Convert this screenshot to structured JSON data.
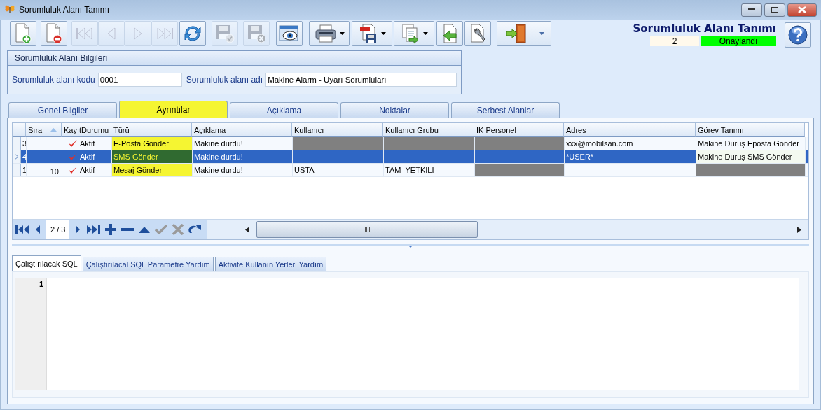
{
  "window": {
    "title": "Sorumluluk Alanı Tanımı"
  },
  "toolbar": [
    {
      "kind": "new",
      "disabled": false,
      "dropdown": false
    },
    {
      "kind": "delete",
      "disabled": false,
      "dropdown": false
    },
    {
      "kind": "first",
      "disabled": true,
      "dropdown": false
    },
    {
      "kind": "prev",
      "disabled": true,
      "dropdown": false
    },
    {
      "kind": "next",
      "disabled": true,
      "dropdown": false
    },
    {
      "kind": "last",
      "disabled": true,
      "dropdown": false
    },
    {
      "kind": "refresh",
      "disabled": false,
      "dropdown": false
    },
    {
      "kind": "save",
      "disabled": true,
      "dropdown": false
    },
    {
      "kind": "cancel",
      "disabled": true,
      "dropdown": false
    },
    {
      "kind": "preview",
      "disabled": false,
      "dropdown": false
    },
    {
      "kind": "print",
      "disabled": false,
      "dropdown": true
    },
    {
      "kind": "pdf",
      "disabled": false,
      "dropdown": true
    },
    {
      "kind": "export",
      "disabled": false,
      "dropdown": true
    },
    {
      "kind": "import",
      "disabled": false,
      "dropdown": false
    },
    {
      "kind": "tools",
      "disabled": false,
      "dropdown": false
    },
    {
      "kind": "exit",
      "disabled": false,
      "dropdown": true
    }
  ],
  "header": {
    "title": "Sorumluluk Alanı Tanımı",
    "count": "2",
    "status": "Onaylandı"
  },
  "info_group": {
    "title": "Sorumluluk Alanı Bilgileri",
    "fields": [
      {
        "label": "Sorumluluk alanı kodu",
        "value": "0001"
      },
      {
        "label": "Sorumluluk alanı adı",
        "value": "Makine Alarm - Uyarı Sorumluları"
      }
    ]
  },
  "tabs": [
    {
      "label": "Genel Bilgiler",
      "selected": false
    },
    {
      "label": "Ayrıntılar",
      "selected": true
    },
    {
      "label": "Açıklama",
      "selected": false
    },
    {
      "label": "Noktalar",
      "selected": false
    },
    {
      "label": "Serbest Alanlar",
      "selected": false
    }
  ],
  "table": {
    "columns": [
      {
        "label": "Sıra",
        "sorted": true,
        "highlight": false
      },
      {
        "label": "KayıtDurumu",
        "sorted": false,
        "highlight": false
      },
      {
        "label": "Türü",
        "sorted": false,
        "highlight": true
      },
      {
        "label": "Açıklama",
        "sorted": false,
        "highlight": false
      },
      {
        "label": "Kullanıcı",
        "sorted": false,
        "highlight": false
      },
      {
        "label": "Kullanıcı Grubu",
        "sorted": false,
        "highlight": false
      },
      {
        "label": "IK Personel",
        "sorted": false,
        "highlight": false
      },
      {
        "label": "Adres",
        "sorted": false,
        "highlight": false
      },
      {
        "label": "Görev Tanımı",
        "sorted": false,
        "highlight": false
      }
    ],
    "rows": [
      {
        "number": "3",
        "selected": false,
        "cells": [
          {
            "shaded": false
          },
          {
            "text": "Aktif",
            "shaded": false
          },
          {
            "text": "E-Posta Gönder",
            "shaded": false
          },
          {
            "text": "Makine durdu!",
            "shaded": false
          },
          {
            "shaded": true
          },
          {
            "shaded": true
          },
          {
            "shaded": true
          },
          {
            "text": "xxx@mobilsan.com",
            "shaded": false
          },
          {
            "text": "Makine Duruş Eposta Gönder",
            "shaded": false
          }
        ]
      },
      {
        "number": "4",
        "selected": true,
        "cells": [
          {
            "shaded": false
          },
          {
            "text": "Aktif",
            "shaded": false
          },
          {
            "text": "SMS Gönder",
            "shaded": false
          },
          {
            "text": "Makine durdu!",
            "shaded": false
          },
          {
            "shaded": false
          },
          {
            "shaded": false
          },
          {
            "shaded": false
          },
          {
            "text": "*USER*",
            "shaded": false
          },
          {
            "text": "Makine Duruş SMS Gönder",
            "shaded": false
          }
        ]
      },
      {
        "number": "1",
        "selected": false,
        "cells": [
          {
            "text": "10",
            "shaded": false
          },
          {
            "text": "Aktif",
            "shaded": false
          },
          {
            "text": "Mesaj Gönder",
            "shaded": false
          },
          {
            "text": "Makine durdu!",
            "shaded": false
          },
          {
            "text": "USTA",
            "shaded": false
          },
          {
            "text": "TAM_YETKILI",
            "shaded": false
          },
          {
            "shaded": true
          },
          {
            "shaded": false
          },
          {
            "shaded": true
          }
        ]
      }
    ]
  },
  "navigator": {
    "position": "2 / 3"
  },
  "bottom_tabs": [
    {
      "label": "Çalıştırılacak SQL",
      "selected": true
    },
    {
      "label": "Çalıştırılacal SQL Parametre Yardım",
      "selected": false
    },
    {
      "label": "Aktivite Kullanın Yerleri Yardım",
      "selected": false
    }
  ],
  "editor": {
    "line_number": "1"
  }
}
